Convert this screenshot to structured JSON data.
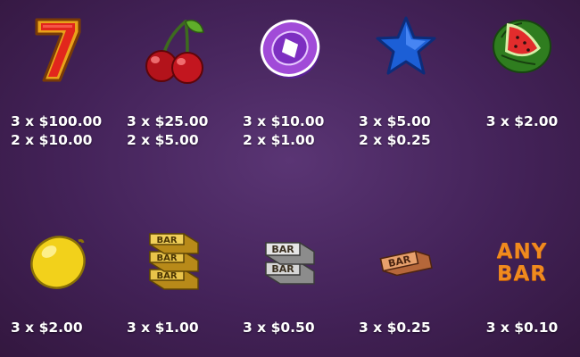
{
  "paytable": {
    "symbols": [
      {
        "icon": "seven-icon",
        "pays": [
          "3 x $100.00",
          "2 x $10.00"
        ]
      },
      {
        "icon": "cherries-icon",
        "pays": [
          "3 x $25.00",
          "2 x $5.00"
        ]
      },
      {
        "icon": "chip-icon",
        "pays": [
          "3 x $10.00",
          "2 x $1.00"
        ]
      },
      {
        "icon": "star-icon",
        "pays": [
          "3 x $5.00",
          "2 x $0.25"
        ]
      },
      {
        "icon": "watermelon-icon",
        "pays": [
          "3 x $2.00"
        ]
      },
      {
        "icon": "lemon-icon",
        "pays": [
          "3 x $2.00"
        ]
      },
      {
        "icon": "gold-triple-bar-icon",
        "pays": [
          "3 x $1.00"
        ]
      },
      {
        "icon": "silver-double-bar-icon",
        "pays": [
          "3 x $0.50"
        ]
      },
      {
        "icon": "bronze-bar-icon",
        "pays": [
          "3 x $0.25"
        ]
      },
      {
        "icon": "any-bar-icon",
        "pays": [
          "3 x $0.10"
        ],
        "label_line1": "ANY",
        "label_line2": "BAR"
      }
    ],
    "bar_label": "BAR"
  },
  "colors": {
    "background": "#432258",
    "text": "#ffffff",
    "any_bar": "#f08a1e"
  }
}
